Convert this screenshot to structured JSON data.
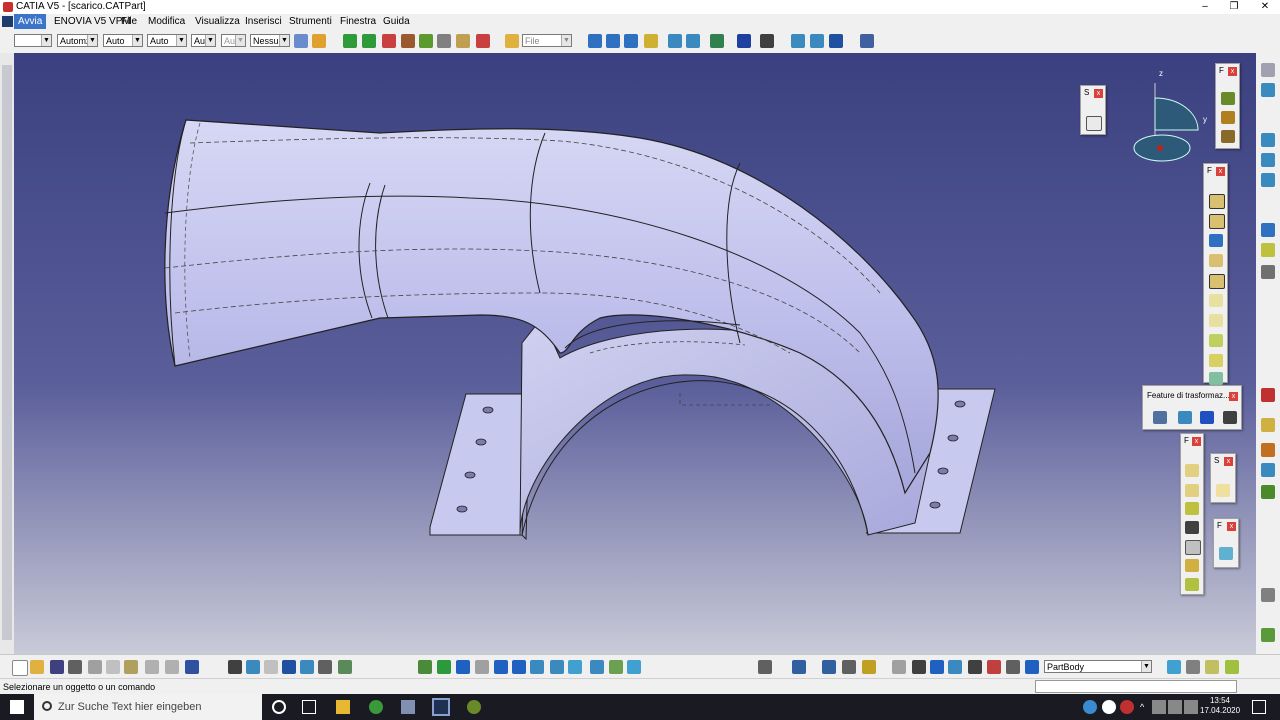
{
  "window": {
    "title": "CATIA V5 - [scarico.CATPart]",
    "min": "–",
    "max": "❐",
    "close": "✕"
  },
  "menu": {
    "items": [
      "Avvia",
      "ENOVIA V5 VPM",
      "File",
      "Modifica",
      "Visualizza",
      "Inserisci",
      "Strumenti",
      "Finestra",
      "Guida"
    ]
  },
  "toolbar_top": {
    "combos": [
      "",
      "Automz",
      "Auto",
      "Auto",
      "Aut",
      "Aut",
      "Nessuno"
    ],
    "file_combo": "File"
  },
  "compass": {
    "z": "z",
    "y": "y"
  },
  "panels": {
    "transform_title": "Feature di trasformaz...",
    "small_labels": [
      "S",
      "F",
      "F",
      "F",
      "S",
      "F"
    ]
  },
  "toolbar_bottom": {
    "part_combo": "PartBody"
  },
  "status": {
    "message": "Selezionare un oggetto o un comando"
  },
  "taskbar": {
    "search_placeholder": "Zur Suche Text hier eingeben",
    "time": "13:54",
    "date": "17.04.2020"
  },
  "colors": {
    "viewport_top": "#3b4080",
    "viewport_bottom": "#c9cad8",
    "part_face": "#c8c9ee",
    "accent": "#3b74c8"
  }
}
